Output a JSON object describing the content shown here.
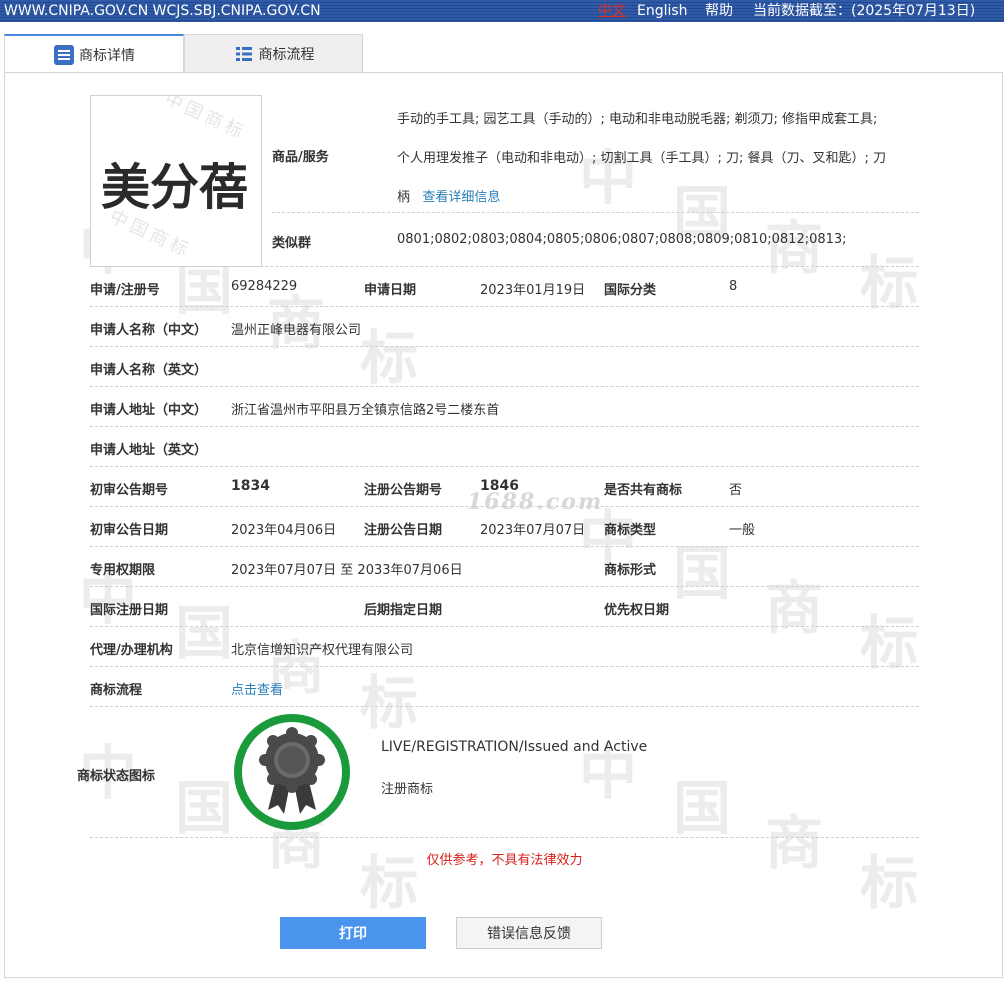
{
  "topbar": {
    "site": "WWW.CNIPA.GOV.CN WCJS.SBJ.CNIPA.GOV.CN",
    "lang_cn": "中文",
    "lang_en": "English",
    "help": "帮助",
    "as_of": "当前数据截至：(2025年07月13日)"
  },
  "tabs": {
    "detail": "商标详情",
    "process": "商标流程"
  },
  "logo": {
    "text": "美分蓓"
  },
  "watermark": {
    "chars": [
      "中",
      "国",
      "商",
      "标"
    ],
    "overlay_text": "1688.com"
  },
  "goods": {
    "label": "商品/服务",
    "line1": "手动的手工具; 园艺工具（手动的）; 电动和非电动脱毛器; 剃须刀; 修指甲成套工具;",
    "line2": "个人用理发推子（电动和非电动）; 切割工具（手工具）; 刀; 餐具（刀、叉和匙）; 刀",
    "line3": "柄",
    "detail_link": "查看详细信息"
  },
  "similar_group": {
    "label": "类似群",
    "value": "0801;0802;0803;0804;0805;0806;0807;0808;0809;0810;0812;0813;"
  },
  "fields": {
    "reg_no_label": "申请/注册号",
    "reg_no": "69284229",
    "app_date_label": "申请日期",
    "app_date": "2023年01月19日",
    "intl_class_label": "国际分类",
    "intl_class": "8",
    "applicant_cn_label": "申请人名称（中文）",
    "applicant_cn": "温州正峰电器有限公司",
    "applicant_en_label": "申请人名称（英文）",
    "applicant_en": "",
    "address_cn_label": "申请人地址（中文）",
    "address_cn": "浙江省温州市平阳县万全镇京信路2号二楼东首",
    "address_en_label": "申请人地址（英文）",
    "address_en": "",
    "prelim_issue_label": "初审公告期号",
    "prelim_issue": "1834",
    "reg_issue_label": "注册公告期号",
    "reg_issue": "1846",
    "shared_label": "是否共有商标",
    "shared": "否",
    "prelim_date_label": "初审公告日期",
    "prelim_date": "2023年04月06日",
    "reg_date_label": "注册公告日期",
    "reg_date": "2023年07月07日",
    "tm_type_label": "商标类型",
    "tm_type": "一般",
    "exclusive_label": "专用权期限",
    "exclusive": "2023年07月07日 至 2033年07月06日",
    "tm_form_label": "商标形式",
    "tm_form": "",
    "intl_reg_date_label": "国际注册日期",
    "intl_reg_date": "",
    "later_date_label": "后期指定日期",
    "later_date": "",
    "priority_label": "优先权日期",
    "priority": "",
    "agent_label": "代理/办理机构",
    "agent": "北京信增知识产权代理有限公司",
    "process_label": "商标流程",
    "process_link": "点击查看"
  },
  "status": {
    "label": "商标状态图标",
    "en": "LIVE/REGISTRATION/Issued and Active",
    "cn": "注册商标",
    "ring_color": "#1a9a3a"
  },
  "disclaimer": "仅供参考，不具有法律效力",
  "buttons": {
    "print": "打印",
    "feedback": "错误信息反馈"
  }
}
